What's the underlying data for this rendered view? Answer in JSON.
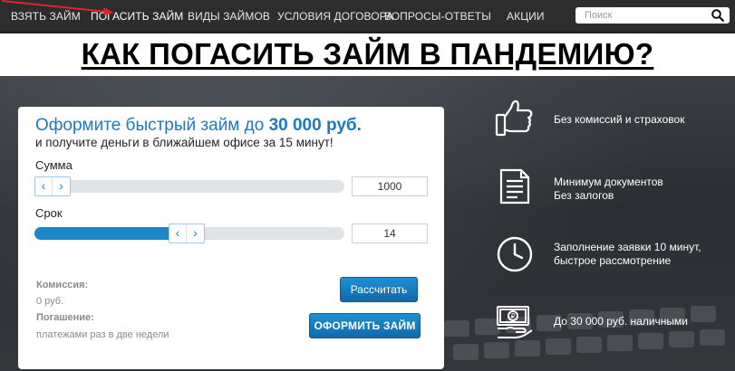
{
  "nav": {
    "items": [
      {
        "label": "Взять займ"
      },
      {
        "label": "Погасить займ"
      },
      {
        "label": "Виды займов"
      },
      {
        "label": "Условия договора"
      },
      {
        "label": "Вопросы-ответы"
      },
      {
        "label": "Акции"
      }
    ],
    "active_index": 1,
    "search": {
      "placeholder": "Поиск",
      "value": ""
    }
  },
  "headline": "КАК ПОГАСИТЬ ЗАЙМ В ПАНДЕМИЮ?",
  "card": {
    "title_prefix": "Оформите быстрый займ до ",
    "title_amount": "30 000 руб.",
    "subtitle": "и получите деньги в ближайшем офисе за 15 минут!",
    "sum": {
      "label": "Сумма",
      "value": "1000",
      "fraction": 0.0
    },
    "term": {
      "label": "Срок",
      "value": "14",
      "fraction": 0.49
    },
    "commission_label": "Комиссия:",
    "commission_value": "0 руб.",
    "repayment_label": "Погашение:",
    "repayment_value": "платежами раз в две недели",
    "calc_button": "Рассчитать",
    "apply_button": "ОФОРМИТЬ ЗАЙМ"
  },
  "features": [
    {
      "icon": "thumbs-up-icon",
      "lines": [
        "Без комиссий и страховок"
      ]
    },
    {
      "icon": "document-icon",
      "lines": [
        "Минимум документов",
        "Без залогов"
      ]
    },
    {
      "icon": "clock-icon",
      "lines": [
        "Заполнение заявки 10 минут,",
        "быстрое рассмотрение"
      ]
    },
    {
      "icon": "cash-hand-icon",
      "lines": [
        "До 30 000 руб. наличными"
      ]
    }
  ],
  "colors": {
    "nav_bg": "#2d2d2d",
    "accent": "#1d86c9",
    "annotation_arrow": "#e0242a"
  }
}
